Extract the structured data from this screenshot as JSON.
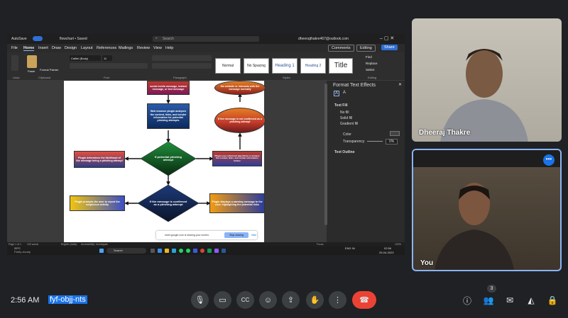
{
  "word": {
    "autosave": "AutoSave",
    "title": "flowchart • Saved",
    "search_placeholder": "Search",
    "account": "dheerajthakre467@outlook.com",
    "menu": [
      "File",
      "Home",
      "Insert",
      "Draw",
      "Design",
      "Layout",
      "References",
      "Mailings",
      "Review",
      "View",
      "Help"
    ],
    "comments": "Comments",
    "editing": "Editing",
    "share": "Share",
    "ribbon": {
      "paste": "Paste",
      "format_painter": "Format Painter",
      "font_name": "Calibri (Body)",
      "font_size": "11",
      "styles": [
        "Normal",
        "No Spacing",
        "Heading 1",
        "Heading 2",
        "Title"
      ],
      "find": "Find",
      "replace": "Replace",
      "select": "Select",
      "groups": [
        "Undo",
        "Clipboard",
        "Font",
        "Paragraph",
        "Styles",
        "Editing"
      ]
    },
    "pane": {
      "title": "Format Text Effects",
      "text_fill": "Text Fill",
      "no_fill": "No fill",
      "solid_fill": "Solid fill",
      "gradient_fill": "Gradient fill",
      "color": "Color",
      "transparency": "Transparency",
      "transparency_value": "0%",
      "text_outline": "Text Outline"
    },
    "status": {
      "page": "Page 1 of 1",
      "words": "102 words",
      "language": "English (India)",
      "accessibility": "Accessibility: Investigate",
      "focus": "Focus",
      "zoom": "100%"
    },
    "share_bubble": {
      "message": "meet.google.com is sharing your screen.",
      "stop": "Stop sharing",
      "hide": "Hide"
    },
    "taskbar": {
      "weather_temp": "29°C",
      "weather_desc": "Partly cloudy",
      "search": "Search",
      "lang": "ENG IN",
      "time": "02:56",
      "date": "25-04-2023"
    }
  },
  "flowchart": {
    "n_top": "social media message, instant message, or text message",
    "n_top_right": "the website or interacts with the message normally",
    "n_analyze": "Web browser plugin analyzes the content, links, and sender information for potential phishing attempts",
    "n_notconfirmed": "If the message is not confirmed as a phishing attempt",
    "n_decision1": "If potential phishing attempt",
    "n_determine": "Plugin determines the likelihood of the message being a phishing attempt",
    "n_advanced": "Plugin uses advanced algorithms to analyze the content, links, and sender information further",
    "n_decision2": "If the message is confirmed as a phishing attempt",
    "n_prompts": "Plugin prompts the user to report the suspicious activity",
    "n_warning": "Plugin displays a warning message to the user, highlighting the potential risks"
  },
  "meet": {
    "participant1": "Dheeraj Thakre",
    "participant2": "You",
    "time": "2:56 AM",
    "meeting_code": "fyf-objj-nts",
    "people_count": "3"
  }
}
